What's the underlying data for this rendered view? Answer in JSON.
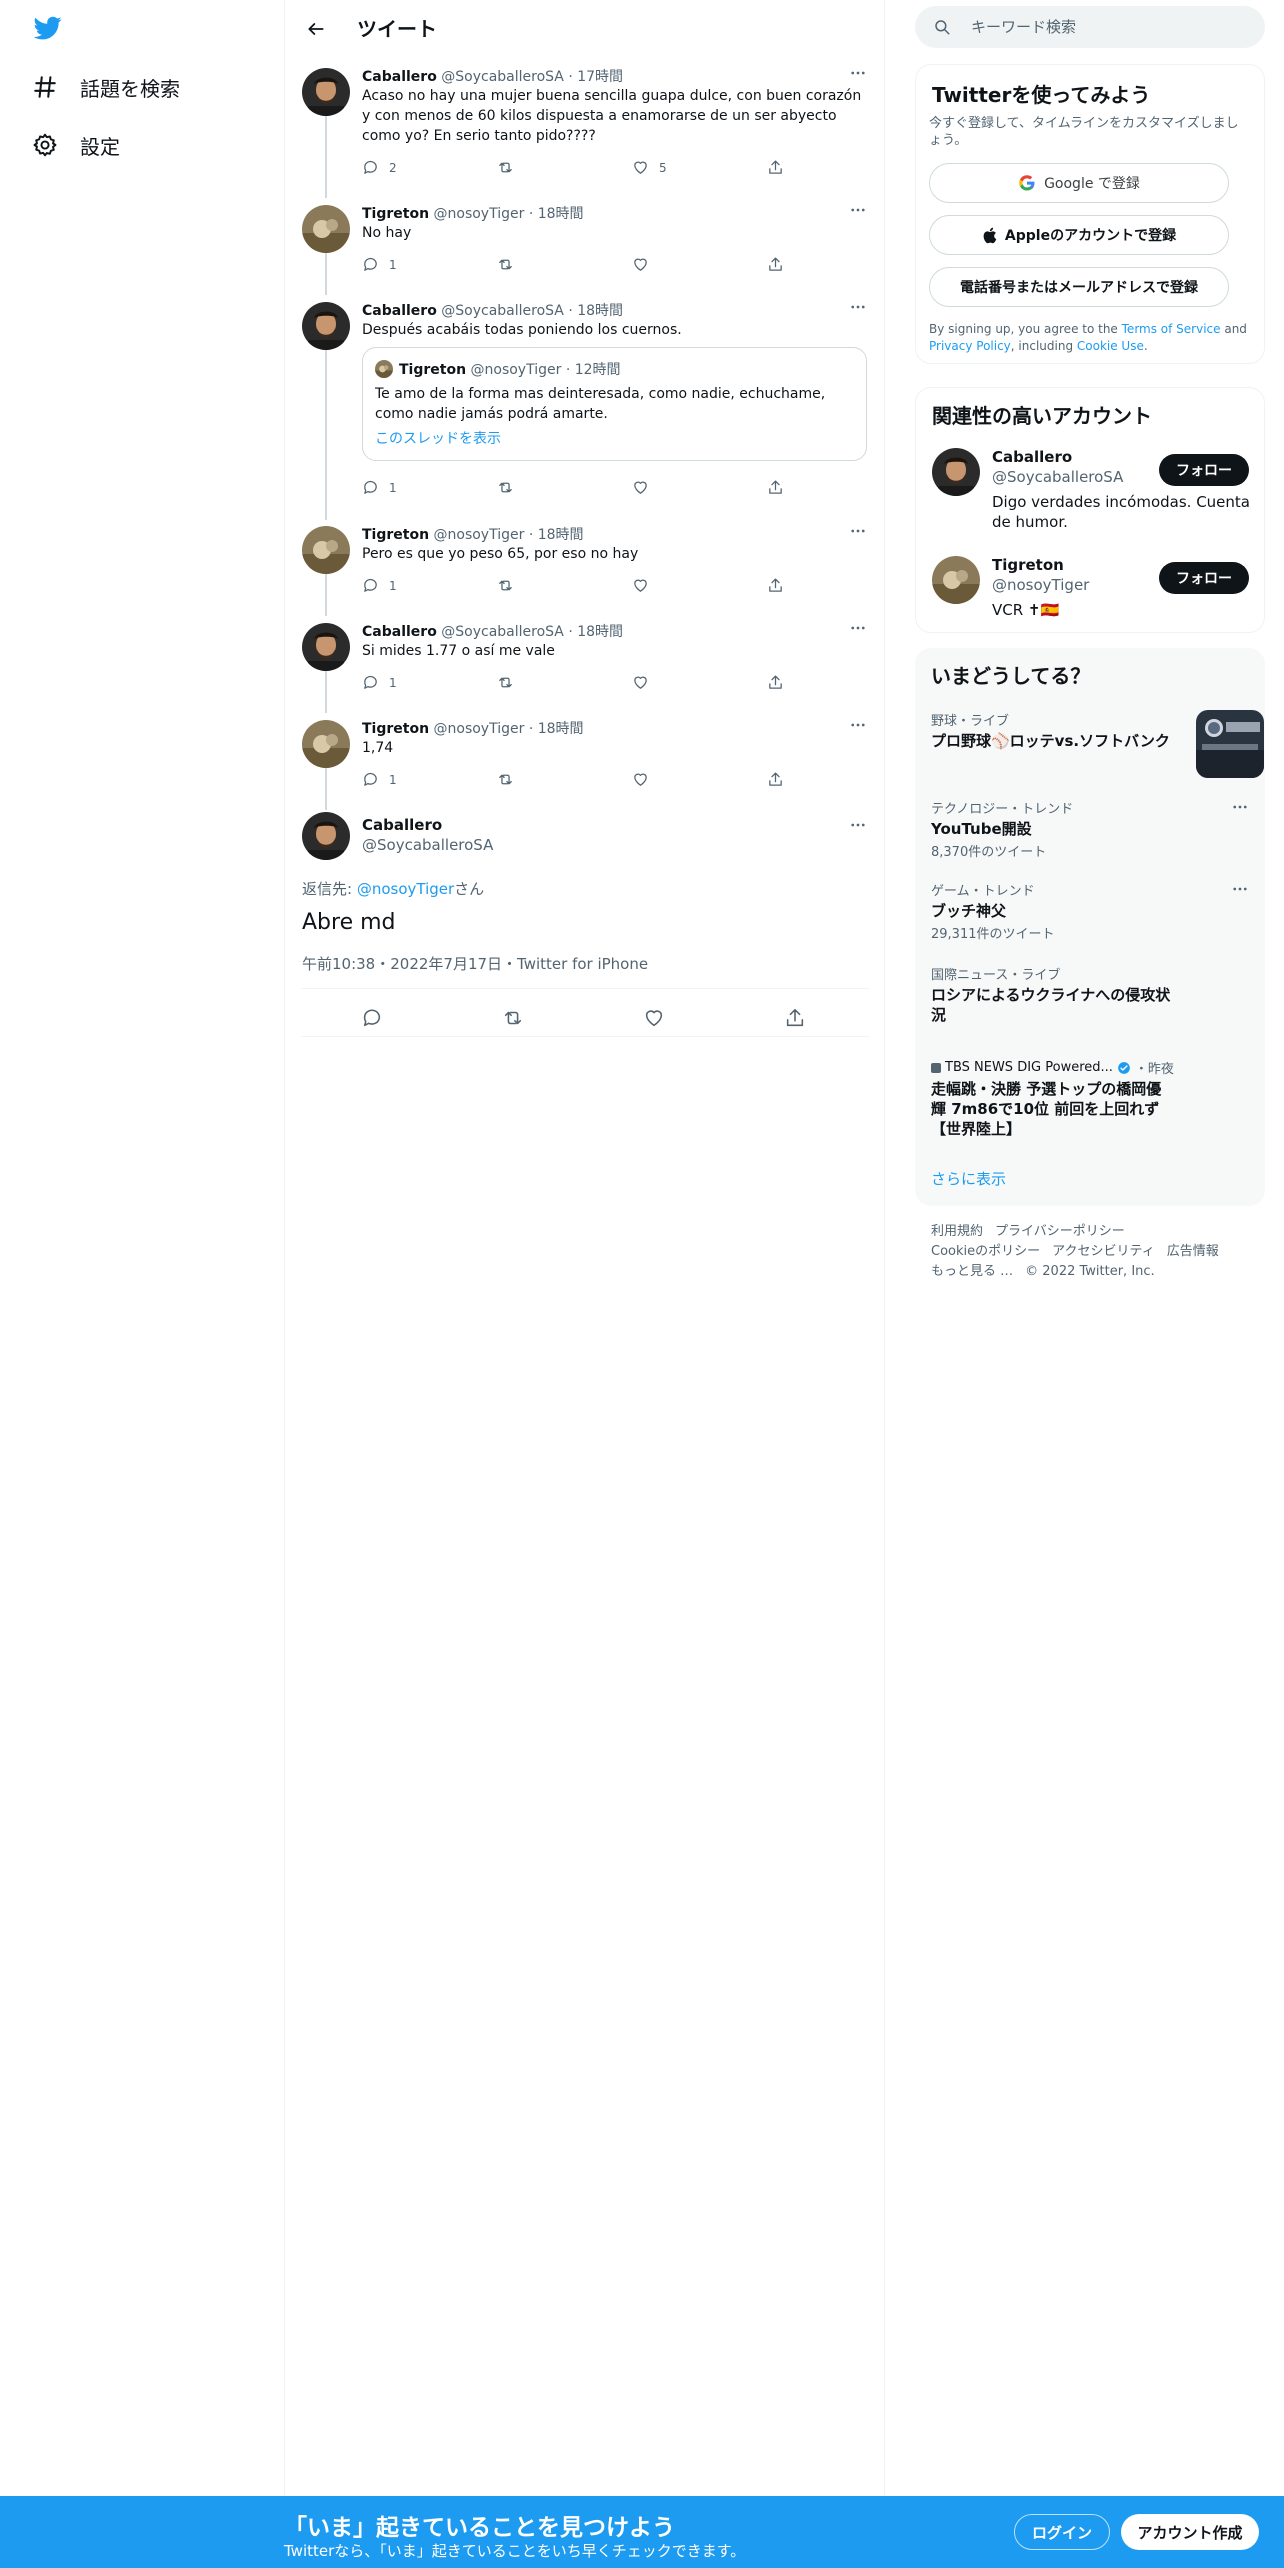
{
  "nav": {
    "explore_label": "話題を検索",
    "settings_label": "設定"
  },
  "header": {
    "title": "ツイート"
  },
  "thread": [
    {
      "name": "Caballero",
      "handle": "@SoycaballeroSA",
      "time": "17時間",
      "text": "Acaso no hay una mujer buena sencilla guapa dulce, con buen corazón y con menos de 60 kilos dispuesta a enamorarse de un ser abyecto como yo? En serio tanto pido????",
      "replies": "2",
      "retweets": "",
      "likes": "5"
    },
    {
      "name": "Tigreton",
      "handle": "@nosoyTiger",
      "time": "18時間",
      "text": "No hay",
      "replies": "1",
      "retweets": "",
      "likes": ""
    },
    {
      "name": "Caballero",
      "handle": "@SoycaballeroSA",
      "time": "18時間",
      "text": "Después acabáis todas poniendo los cuernos.",
      "replies": "1",
      "retweets": "",
      "likes": "",
      "quote": {
        "name": "Tigreton",
        "handle": "@nosoyTiger",
        "time": "12時間",
        "text": "Te amo de la forma mas deinteresada, como nadie, echuchame, como nadie jamás podrá amarte.",
        "link": "このスレッドを表示"
      }
    },
    {
      "name": "Tigreton",
      "handle": "@nosoyTiger",
      "time": "18時間",
      "text": "Pero es que yo peso 65, por eso no hay",
      "replies": "1",
      "retweets": "",
      "likes": ""
    },
    {
      "name": "Caballero",
      "handle": "@SoycaballeroSA",
      "time": "18時間",
      "text": "Si mides 1.77 o así me vale",
      "replies": "1",
      "retweets": "",
      "likes": ""
    },
    {
      "name": "Tigreton",
      "handle": "@nosoyTiger",
      "time": "18時間",
      "text": "1,74",
      "replies": "1",
      "retweets": "",
      "likes": ""
    }
  ],
  "focus": {
    "name": "Caballero",
    "handle": "@SoycaballeroSA",
    "replying_prefix": "返信先: ",
    "replying_to": "@nosoyTiger",
    "replying_suffix": "さん",
    "text": "Abre md",
    "date": "午前10:38・2022年7月17日・Twitter for iPhone"
  },
  "search": {
    "placeholder": "キーワード検索"
  },
  "signup": {
    "title": "Twitterを使ってみよう",
    "subtitle": "今すぐ登録して、タイムラインをカスタマイズしましょう。",
    "google_label": "Google で登録",
    "apple_label": "Appleのアカウントで登録",
    "phone_label": "電話番号またはメールアドレスで登録",
    "legal_prefix": "By signing up, you agree to the ",
    "legal_terms": "Terms of Service",
    "legal_and": " and ",
    "legal_privacy": "Privacy Policy",
    "legal_including": ", including ",
    "legal_cookie": "Cookie Use",
    "legal_end": "."
  },
  "relevant": {
    "title": "関連性の高いアカウント",
    "follow_label": "フォロー",
    "accounts": [
      {
        "name": "Caballero",
        "handle": "@SoycaballeroSA",
        "bio": "Digo verdades incómodas. Cuenta de humor."
      },
      {
        "name": "Tigreton",
        "handle": "@nosoyTiger",
        "bio": "VCR ✝🇪🇸"
      }
    ]
  },
  "trends": {
    "title": "いまどうしてる？",
    "items": [
      {
        "category": "野球・ライブ",
        "title": "プロ野球⚾ロッテvs.ソフトバンク",
        "count": ""
      },
      {
        "category": "テクノロジー・トレンド",
        "title": "YouTube開設",
        "count": "8,370件のツイート"
      },
      {
        "category": "ゲーム・トレンド",
        "title": "ブッチ神父",
        "count": "29,311件のツイート"
      },
      {
        "category": "国際ニュース・ライブ",
        "title": "ロシアによるウクライナへの侵攻状況",
        "count": ""
      },
      {
        "category": "",
        "source": "TBS NEWS DIG Powered...",
        "source_time": "・昨夜",
        "title": "走幅跳・決勝 予選トップの橋岡優輝 7m86で10位 前回を上回れず【世界陸上】",
        "count": ""
      }
    ],
    "show_more": "さらに表示"
  },
  "footer": {
    "links": [
      "利用規約",
      "プライバシーポリシー",
      "Cookieのポリシー",
      "アクセシビリティ",
      "広告情報",
      "もっと見る …",
      "© 2022 Twitter, Inc."
    ]
  },
  "banner": {
    "title": "「いま」起きていることを見つけよう",
    "subtitle": "Twitterなら、「いま」起きていることをいち早くチェックできます。",
    "login_label": "ログイン",
    "register_label": "アカウント作成"
  },
  "colors": {
    "accent": "#1d9bf0",
    "text": "#0f1419",
    "secondary_text": "#536471",
    "border": "#eff3f4",
    "trends_bg": "#f7f9f9",
    "follow_button": "#0f1419"
  },
  "icons": [
    "twitter-bird-icon",
    "hashtag-icon",
    "gear-icon",
    "back-arrow-icon",
    "search-icon",
    "more-icon",
    "reply-icon",
    "retweet-icon",
    "like-icon",
    "share-icon",
    "google-icon",
    "apple-icon",
    "verified-icon"
  ]
}
